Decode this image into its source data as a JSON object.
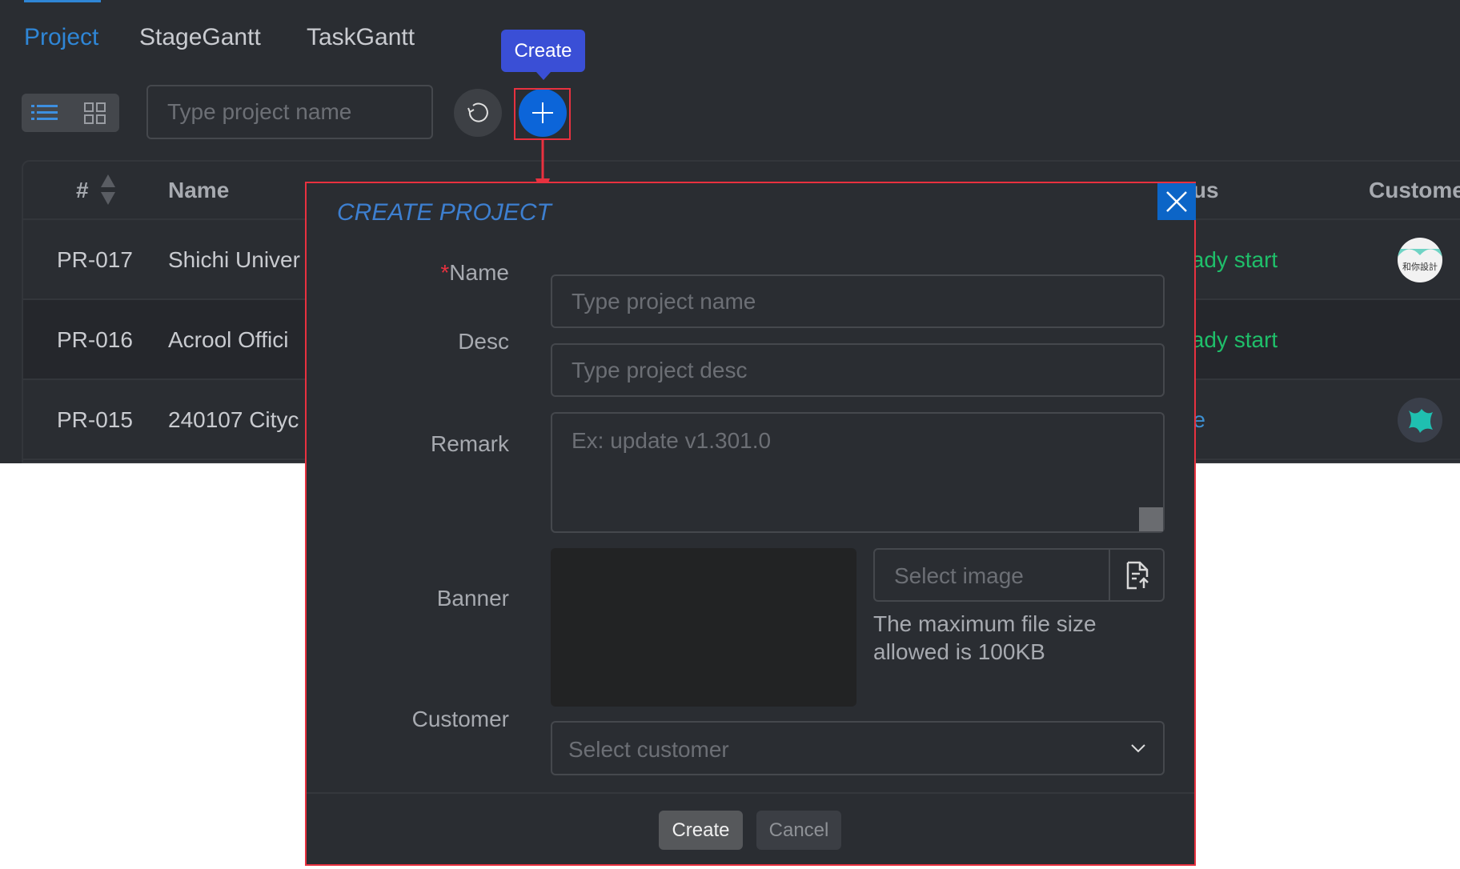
{
  "tabs": [
    {
      "label": "Project",
      "active": true
    },
    {
      "label": "StageGantt"
    },
    {
      "label": "TaskGantt"
    }
  ],
  "toolbar": {
    "search_placeholder": "Type project name",
    "tooltip": "Create",
    "view_modes": [
      "list-icon",
      "grid-icon"
    ],
    "refresh_icon": "refresh-icon",
    "create_icon": "plus-icon"
  },
  "table": {
    "headers": {
      "id": "#",
      "name": "Name",
      "status": "Status",
      "customer": "Customer"
    },
    "rows": [
      {
        "id": "PR-017",
        "name": "Shichi Univer",
        "status": "Already start",
        "avatar": "customer-logo-teal-arches"
      },
      {
        "id": "PR-016",
        "name": "Acrool Offici",
        "status": "Already start",
        "avatar": ""
      },
      {
        "id": "PR-015",
        "name": "240107 Cityc",
        "status": "Done",
        "avatar": "customer-logo-teal-cactus"
      }
    ]
  },
  "modal": {
    "title": "CREATE PROJECT",
    "fields": {
      "name": {
        "label": "Name",
        "required_mark": "*",
        "placeholder": "Type project name",
        "value": ""
      },
      "desc": {
        "label": "Desc",
        "placeholder": "Type project desc",
        "value": ""
      },
      "remark": {
        "label": "Remark",
        "placeholder": "Ex: update v1.301.0",
        "value": ""
      },
      "banner": {
        "label": "Banner",
        "select_placeholder": "Select image",
        "help": "The maximum file size allowed is 100KB"
      },
      "customer": {
        "label": "Customer",
        "placeholder": "Select customer"
      }
    },
    "create_label": "Create",
    "cancel_label": "Cancel"
  },
  "colors": {
    "accent": "#2f86d6",
    "primary_button": "#0c65c7",
    "tooltip": "#3a4fd6",
    "status_started": "#1fbf6a",
    "status_done": "#3d8fd0",
    "highlight": "#e8313f"
  }
}
